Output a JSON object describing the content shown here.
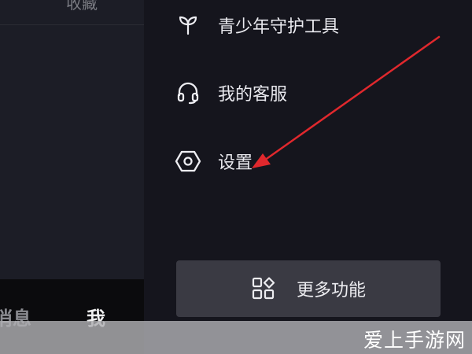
{
  "left_panel": {
    "top_label": "收藏"
  },
  "tabbar": {
    "messages_label": "消息",
    "me_label": "我"
  },
  "drawer": {
    "items": [
      {
        "label": "青少年守护工具",
        "icon": "sprout-icon"
      },
      {
        "label": "我的客服",
        "icon": "headset-icon"
      },
      {
        "label": "设置",
        "icon": "hexagon-settings-icon"
      }
    ],
    "more_button": {
      "label": "更多功能",
      "icon": "grid-shapes-icon"
    }
  },
  "annotation": {
    "arrow_color": "#e0282d",
    "points_to": "设置"
  },
  "watermark": {
    "text": "爱上手游网"
  },
  "colors": {
    "drawer_bg": "#15151d",
    "left_bg": "#1c1d26",
    "button_bg": "#3a3a43",
    "text": "#e9e9ee"
  }
}
